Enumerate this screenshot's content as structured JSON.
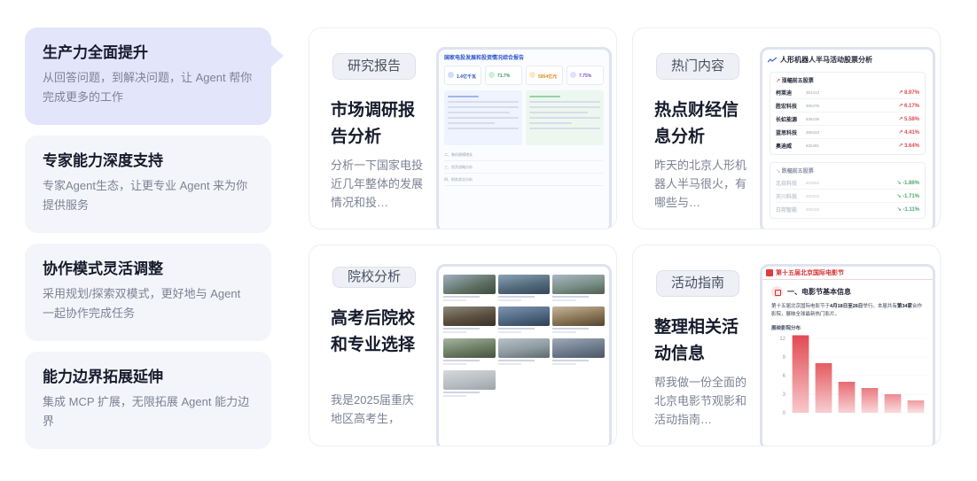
{
  "features": [
    {
      "title": "生产力全面提升",
      "desc": "从回答问题，到解决问题，让 Agent 帮你完成更多的工作",
      "active": true
    },
    {
      "title": "专家能力深度支持",
      "desc": "专家Agent生态，让更专业 Agent 来为你提供服务",
      "active": false
    },
    {
      "title": "协作模式灵活调整",
      "desc": "采用规划/探索双模式，更好地与 Agent 一起协作完成任务",
      "active": false
    },
    {
      "title": "能力边界拓展延伸",
      "desc": "集成 MCP 扩展，无限拓展 Agent 能力边界",
      "active": false
    }
  ],
  "cards": {
    "report": {
      "tag": "研究报告",
      "title": "市场调研报告分析",
      "desc": "分析一下国家电投近几年整体的发展情况和投…",
      "shot": {
        "title": "国家电投发展和投资情况综合报告",
        "stats": [
          "1.4亿千瓦",
          "71.7%",
          "5954亿元",
          "7.75%"
        ],
        "rows": [
          "二、装机规模增长",
          "三、投资战略分析",
          "四、财务状况分析"
        ]
      }
    },
    "hot": {
      "tag": "热门内容",
      "title": "热点财经信息分析",
      "desc": "昨天的北京人形机器人半马很火，有哪些与…",
      "shot": {
        "title": "人形机器人半马活动股票分析",
        "up_title": "涨幅前五股票",
        "up": [
          {
            "name": "柯莱迪",
            "code": "301413",
            "change": "↗ 8.97%"
          },
          {
            "name": "胜宏科技",
            "code": "300476",
            "change": "↗ 6.17%"
          },
          {
            "name": "长虹能源",
            "code": "836239",
            "change": "↗ 5.58%"
          },
          {
            "name": "蓝思科技",
            "code": "300433",
            "change": "↗ 4.41%"
          },
          {
            "name": "奥迪威",
            "code": "832491",
            "change": "↗ 3.64%"
          }
        ],
        "down_title": "跌幅前五股票",
        "down": [
          {
            "name": "北自科技",
            "code": "603082",
            "change": "↘ -1.86%"
          },
          {
            "name": "天川科技",
            "code": "300322",
            "change": "↘ -1.71%"
          },
          {
            "name": "日邦智能",
            "code": "300433",
            "change": "↘ -1.11%"
          }
        ]
      }
    },
    "school": {
      "tag": "院校分析",
      "title": "高考后院校和专业选择",
      "desc": "我是2025届重庆地区高考生，"
    },
    "event": {
      "tag": "活动指南",
      "title": "整理相关活动信息",
      "desc": "帮我做一份全面的北京电影节观影和活动指南…",
      "shot": {
        "bar_title": "第十五届北京国际电影节",
        "section": "一、电影节基本信息",
        "text_a": "第十五届北京国际电影节于",
        "text_b": "4月18日至26日",
        "text_c": "举行。本届共有",
        "text_d": "第34家",
        "text_e": "合作影院，展映全球最新热门影片。",
        "chart_label": "展映影院分布"
      }
    }
  },
  "chart_data": {
    "type": "bar",
    "categories": [
      "",
      "",
      "",
      "",
      "",
      ""
    ],
    "values": [
      12.5,
      8,
      5,
      4,
      3,
      2
    ],
    "yticks": [
      "12",
      "9",
      "6",
      "3",
      "0"
    ],
    "ylim": [
      0,
      12
    ]
  }
}
